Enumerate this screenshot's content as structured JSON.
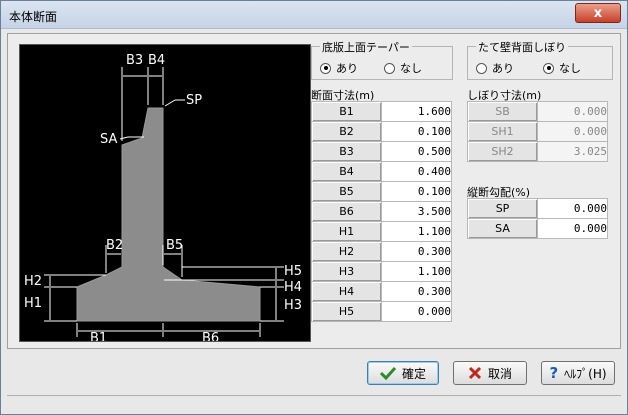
{
  "window": {
    "title": "本体断面",
    "close_symbol": "x"
  },
  "figure": {
    "labels": [
      "B3",
      "B4",
      "SP",
      "SA",
      "B2",
      "B5",
      "H5",
      "H2",
      "H4",
      "H1",
      "H3",
      "B1",
      "B6"
    ]
  },
  "bottom_slab_taper": {
    "legend": "底版上面テーパー",
    "options": [
      {
        "label": "あり",
        "selected": true
      },
      {
        "label": "なし",
        "selected": false
      }
    ]
  },
  "back_wall_taper": {
    "legend": "たて壁背面しぼり",
    "options": [
      {
        "label": "あり",
        "selected": false
      },
      {
        "label": "なし",
        "selected": true
      }
    ]
  },
  "section_dims": {
    "label": "断面寸法(m)",
    "rows": [
      {
        "key": "B1",
        "value": "1.600"
      },
      {
        "key": "B2",
        "value": "0.100"
      },
      {
        "key": "B3",
        "value": "0.500"
      },
      {
        "key": "B4",
        "value": "0.400"
      },
      {
        "key": "B5",
        "value": "0.100"
      },
      {
        "key": "B6",
        "value": "3.500"
      },
      {
        "key": "H1",
        "value": "1.100"
      },
      {
        "key": "H2",
        "value": "0.300"
      },
      {
        "key": "H3",
        "value": "1.100"
      },
      {
        "key": "H4",
        "value": "0.300"
      },
      {
        "key": "H5",
        "value": "0.000"
      }
    ]
  },
  "taper_dims": {
    "label": "しぼり寸法(m)",
    "rows": [
      {
        "key": "SB",
        "value": "0.000"
      },
      {
        "key": "SH1",
        "value": "0.000"
      },
      {
        "key": "SH2",
        "value": "3.025"
      }
    ]
  },
  "slope": {
    "label": "縦断勾配(%)",
    "rows": [
      {
        "key": "SP",
        "value": "0.000"
      },
      {
        "key": "SA",
        "value": "0.000"
      }
    ]
  },
  "buttons": {
    "ok": {
      "label": "確定",
      "icon": "check-icon"
    },
    "cancel": {
      "label": "取消",
      "icon": "x-icon"
    },
    "help": {
      "label": "ﾍﾙﾌﾟ(H)",
      "icon": "question-icon"
    }
  }
}
